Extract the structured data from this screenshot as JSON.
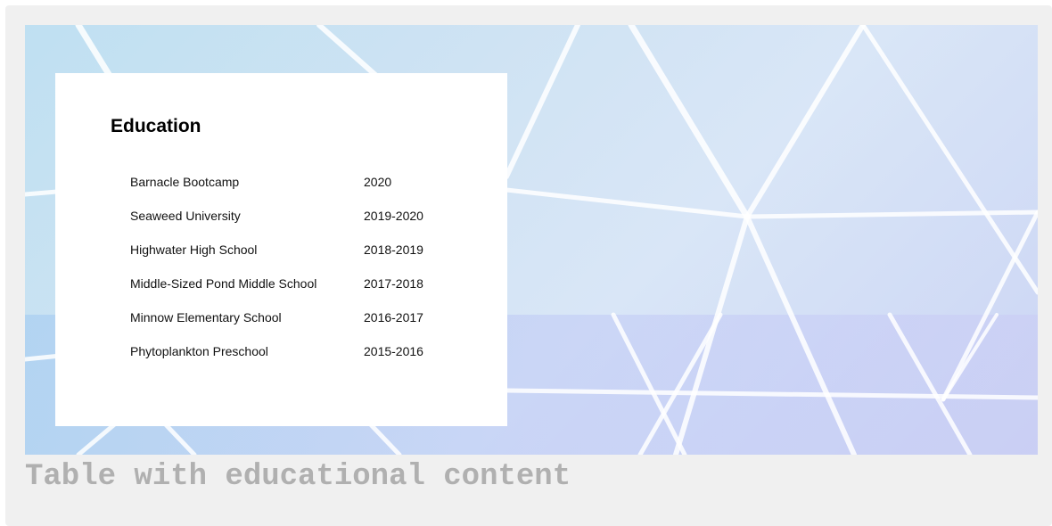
{
  "card": {
    "heading": "Education"
  },
  "education": {
    "rows": [
      {
        "school": "Barnacle Bootcamp",
        "years": "2020"
      },
      {
        "school": "Seaweed University",
        "years": "2019-2020"
      },
      {
        "school": "Highwater High School",
        "years": "2018-2019"
      },
      {
        "school": "Middle-Sized Pond Middle School",
        "years": "2017-2018"
      },
      {
        "school": "Minnow Elementary School",
        "years": "2016-2017"
      },
      {
        "school": "Phytoplankton Preschool",
        "years": "2015-2016"
      }
    ]
  },
  "caption": "Table with educational content",
  "colors": {
    "frame_background": "#f0f0f0",
    "card_background": "#ffffff",
    "caption_text": "#b0b0b0",
    "dome_struts": "#ffffff"
  }
}
